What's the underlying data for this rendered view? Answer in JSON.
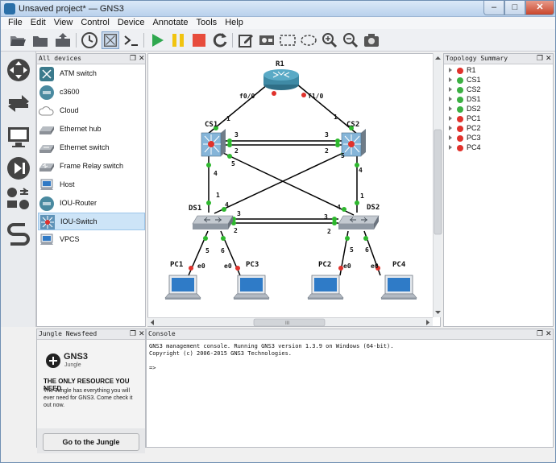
{
  "window": {
    "title": "Unsaved project* — GNS3",
    "colors": {
      "accent": "#2a6fa8",
      "close": "#c9462c"
    }
  },
  "menubar": [
    "File",
    "Edit",
    "View",
    "Control",
    "Device",
    "Annotate",
    "Tools",
    "Help"
  ],
  "toolbar": {
    "icons": [
      "folder-open-icon",
      "folder-icon",
      "export-icon",
      "snapshot-clock-icon",
      "show-interface-labels-icon",
      "console-icon",
      "start-icon",
      "suspend-icon",
      "stop-icon",
      "reload-icon",
      "note-icon",
      "image-icon",
      "rectangle-icon",
      "ellipse-icon",
      "zoom-in-icon",
      "zoom-out-icon",
      "screenshot-icon"
    ]
  },
  "sidebar": {
    "buttons": [
      "routers-icon",
      "switches-icon",
      "end-devices-icon",
      "security-devices-icon",
      "all-devices-icon",
      "add-link-icon"
    ]
  },
  "devices_panel": {
    "title": "All devices",
    "items": [
      {
        "label": "ATM switch",
        "icon": "atm-switch-icon"
      },
      {
        "label": "c3600",
        "icon": "router-icon"
      },
      {
        "label": "Cloud",
        "icon": "cloud-icon"
      },
      {
        "label": "Ethernet hub",
        "icon": "ethernet-hub-icon"
      },
      {
        "label": "Ethernet switch",
        "icon": "ethernet-switch-icon"
      },
      {
        "label": "Frame Relay switch",
        "icon": "frame-relay-icon"
      },
      {
        "label": "Host",
        "icon": "host-icon"
      },
      {
        "label": "IOU-Router",
        "icon": "router-icon"
      },
      {
        "label": "IOU-Switch",
        "icon": "multilayer-switch-icon",
        "selected": true
      },
      {
        "label": "VPCS",
        "icon": "vpcs-icon"
      }
    ]
  },
  "topology_panel": {
    "title": "Topology Summary",
    "items": [
      {
        "label": "R1",
        "status": "stopped"
      },
      {
        "label": "CS1",
        "status": "running"
      },
      {
        "label": "CS2",
        "status": "running"
      },
      {
        "label": "DS1",
        "status": "running"
      },
      {
        "label": "DS2",
        "status": "running"
      },
      {
        "label": "PC1",
        "status": "stopped"
      },
      {
        "label": "PC2",
        "status": "stopped"
      },
      {
        "label": "PC3",
        "status": "stopped"
      },
      {
        "label": "PC4",
        "status": "stopped"
      }
    ],
    "colors": {
      "running": "#3cb043",
      "stopped": "#e0322c"
    }
  },
  "topology": {
    "nodes": {
      "R1": {
        "label": "R1"
      },
      "CS1": {
        "label": "CS1"
      },
      "CS2": {
        "label": "CS2"
      },
      "DS1": {
        "label": "DS1"
      },
      "DS2": {
        "label": "DS2"
      },
      "PC1": {
        "label": "PC1"
      },
      "PC2": {
        "label": "PC2"
      },
      "PC3": {
        "label": "PC3"
      },
      "PC4": {
        "label": "PC4"
      }
    },
    "ports": {
      "r1_f00": "f0/0",
      "r1_f10": "f1/0",
      "cs1_1": "1",
      "cs1_3": "3",
      "cs1_2": "2",
      "cs1_4": "4",
      "cs1_5": "5",
      "cs2_1": "1",
      "cs2_3": "3",
      "cs2_2": "2",
      "cs2_5": "5",
      "cs2_4": "4",
      "ds1_1": "1",
      "ds1_4": "4",
      "ds1_3": "3",
      "ds1_2": "2",
      "ds1_5": "5",
      "ds1_6": "6",
      "ds2_4": "4",
      "ds2_1": "1",
      "ds2_3": "3",
      "ds2_2": "2",
      "ds2_5": "5",
      "ds2_6": "6",
      "pc1_e0": "e0",
      "pc3_e0": "e0",
      "pc2_e0": "e0",
      "pc4_e0": "e0"
    }
  },
  "jungle_panel": {
    "title": "Jungle Newsfeed",
    "logo_text": "GNS3",
    "logo_sub": "Jungle",
    "headline": "THE ONLY RESOURCE YOU NEED",
    "body": "The Jungle has everything you will ever need for GNS3. Come check it out now.",
    "button": "Go to the Jungle"
  },
  "console_panel": {
    "title": "Console",
    "line1": "GNS3 management console. Running GNS3 version 1.3.9 on Windows (64-bit).",
    "line2": "Copyright (c) 2006-2015 GNS3 Technologies.",
    "prompt": "=>"
  },
  "hscroll": {
    "thumb_label": "III"
  }
}
